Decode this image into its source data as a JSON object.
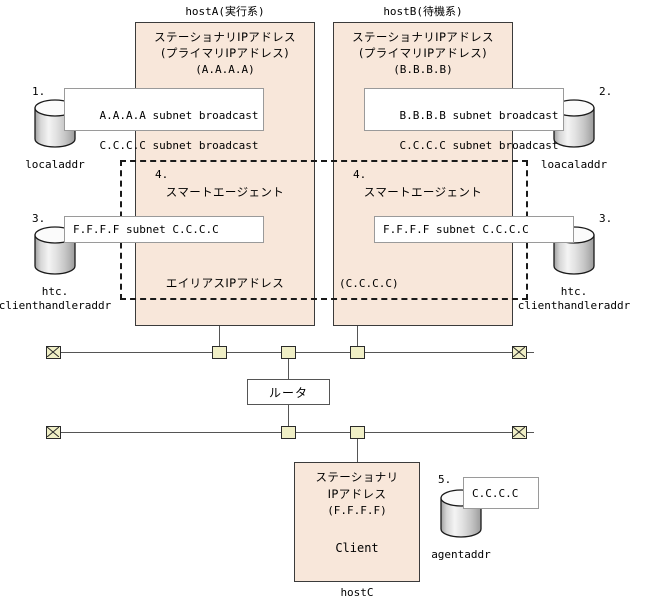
{
  "diagram": {
    "hosts": {
      "hostA": {
        "caption": "hostA(実行系)",
        "stationary_line1": "ステーショナリIPアドレス",
        "stationary_line2": "(プライマリIPアドレス)",
        "stationary_line3": "(A.A.A.A)",
        "alias_label": "エイリアスIPアドレス",
        "agent_num": "4.",
        "agent_label": "スマートエージェント"
      },
      "hostB": {
        "caption": "hostB(待機系)",
        "stationary_line1": "ステーショナリIPアドレス",
        "stationary_line2": "(プライマリIPアドレス)",
        "stationary_line3": "(B.B.B.B)",
        "alias_value": "(C.C.C.C)",
        "agent_num": "4.",
        "agent_label": "スマートエージェント"
      },
      "hostC": {
        "caption": "hostC",
        "stationary_line1": "ステーショナリ",
        "stationary_line2": "IPアドレス",
        "stationary_line3": "(F.F.F.F)",
        "role": "Client"
      }
    },
    "callouts": {
      "localaddr_a_line1": "A.A.A.A subnet broadcast",
      "localaddr_a_line2": "C.C.C.C subnet broadcast",
      "localaddr_b_line1": "B.B.B.B subnet broadcast",
      "localaddr_b_line2": "C.C.C.C subnet broadcast",
      "handler_a": "F.F.F.F subnet C.C.C.C",
      "handler_b": "F.F.F.F subnet C.C.C.C",
      "agentaddr": "C.C.C.C"
    },
    "cylinders": [
      {
        "num": "1.",
        "label_line1": "localaddr",
        "label_line2": ""
      },
      {
        "num": "2.",
        "label_line1": "loacaladdr",
        "label_line2": ""
      },
      {
        "num": "3.",
        "label_line1": "htc.",
        "label_line2": "clienthandleraddr"
      },
      {
        "num": "3.",
        "label_line1": "htc.",
        "label_line2": "clienthandleraddr"
      },
      {
        "num": "5.",
        "label_line1": "agentaddr",
        "label_line2": ""
      }
    ],
    "router": {
      "label": "ルータ"
    },
    "colors": {
      "host_fill": "#F8E7DA",
      "node_fill": "#F0EFC6",
      "callout_fill": "#FFFFFF",
      "line": "#555555",
      "border": "#3B3B3B"
    }
  }
}
